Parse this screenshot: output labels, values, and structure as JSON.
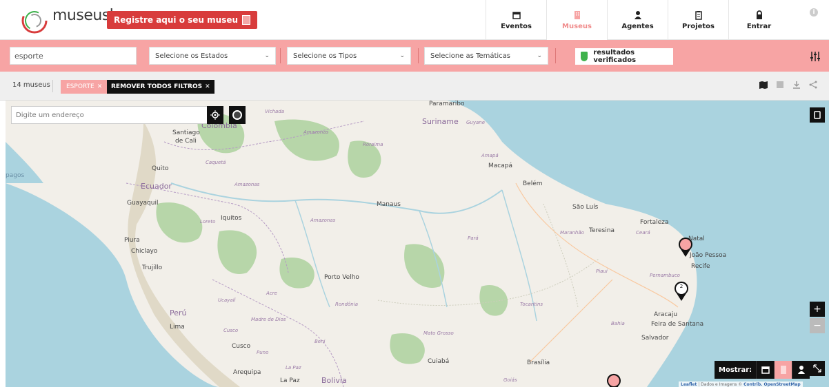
{
  "header": {
    "logo_main": "museus",
    "logo_suffix": "br",
    "register_label": "Registre aqui o seu museu",
    "nav": [
      {
        "label": "Eventos",
        "icon": "calendar-icon"
      },
      {
        "label": "Museus",
        "icon": "building-icon"
      },
      {
        "label": "Agentes",
        "icon": "person-icon"
      },
      {
        "label": "Projetos",
        "icon": "clipboard-icon"
      },
      {
        "label": "Entrar",
        "icon": "lock-icon"
      }
    ]
  },
  "filters": {
    "search_value": "esporte",
    "estados_label": "Selecione os Estados",
    "tipos_label": "Selecione os Tipos",
    "tematicas_label": "Selecione as Temáticas",
    "verified_label": "resultados verificados"
  },
  "results": {
    "count": "14 museus",
    "chip_label": "ESPORTE",
    "remove_all_label": "REMOVER TODOS FILTROS"
  },
  "map": {
    "address_placeholder": "Digite um endereço",
    "show_label": "Mostrar:",
    "zoom_in": "+",
    "zoom_out": "−",
    "attribution_leaflet": "Leaflet",
    "attribution_text": "| Dados e Imagens ©",
    "attribution_contrib": "Contrib. OpenStreetMap",
    "markers": [
      {
        "label": ""
      },
      {
        "label": "2"
      },
      {
        "label": ""
      }
    ],
    "places": {
      "paramaribo": "Paramaribo",
      "suriname": "Suriname",
      "guyane": "Guyane",
      "vichada": "Vichada",
      "santiago": "Santiago",
      "de_cali": "de Cali",
      "colombia": "Colombia",
      "amazonas1": "Amazonas",
      "roraima": "Roraima",
      "amapa": "Amapá",
      "macapa": "Macapá",
      "quito": "Quito",
      "caqueta": "Caquetá",
      "ecuador": "Ecuador",
      "amazonas2": "Amazonas",
      "belem": "Belém",
      "guayaquil": "Guayaquil",
      "manaus": "Manaus",
      "sao_luis": "São Luís",
      "fortaleza": "Fortaleza",
      "loreto": "Loreto",
      "iquitos": "Iquitos",
      "amazonas3": "Amazonas",
      "maranhao": "Maranhão",
      "teresina": "Teresina",
      "ceara": "Ceará",
      "natal": "Natal",
      "para": "Pará",
      "piura": "Piura",
      "chiclayo": "Chiclayo",
      "joao_pessoa": "João Pessoa",
      "trujillo": "Trujillo",
      "recife": "Recife",
      "piaui": "Piauí",
      "pernambuco": "Pernambuco",
      "porto_velho": "Porto Velho",
      "ucayali": "Ucayali",
      "acre": "Acre",
      "rondonia": "Rondônia",
      "tocantins": "Tocantins",
      "peru": "Perú",
      "aracaju": "Aracaju",
      "lima": "Lima",
      "madre_de_dios": "Madre de Dios",
      "bahia": "Bahia",
      "feira": "Feira de Santana",
      "cusco_region": "Cusco",
      "mato_grosso": "Mato Grosso",
      "salvador": "Salvador",
      "cusco": "Cusco",
      "beni": "Beni",
      "puno": "Puno",
      "cuiaba": "Cuiabá",
      "brasilia": "Brasília",
      "arequipa": "Arequipa",
      "la_paz_region": "La Paz",
      "la_paz": "La Paz",
      "bolivia": "Bolivia",
      "goias": "Goiás",
      "pagos": "pagos"
    }
  },
  "colors": {
    "accent": "#f7a4a4",
    "brand_red": "#d83c3c",
    "verified_green": "#3fb24c",
    "dark": "#111111"
  }
}
